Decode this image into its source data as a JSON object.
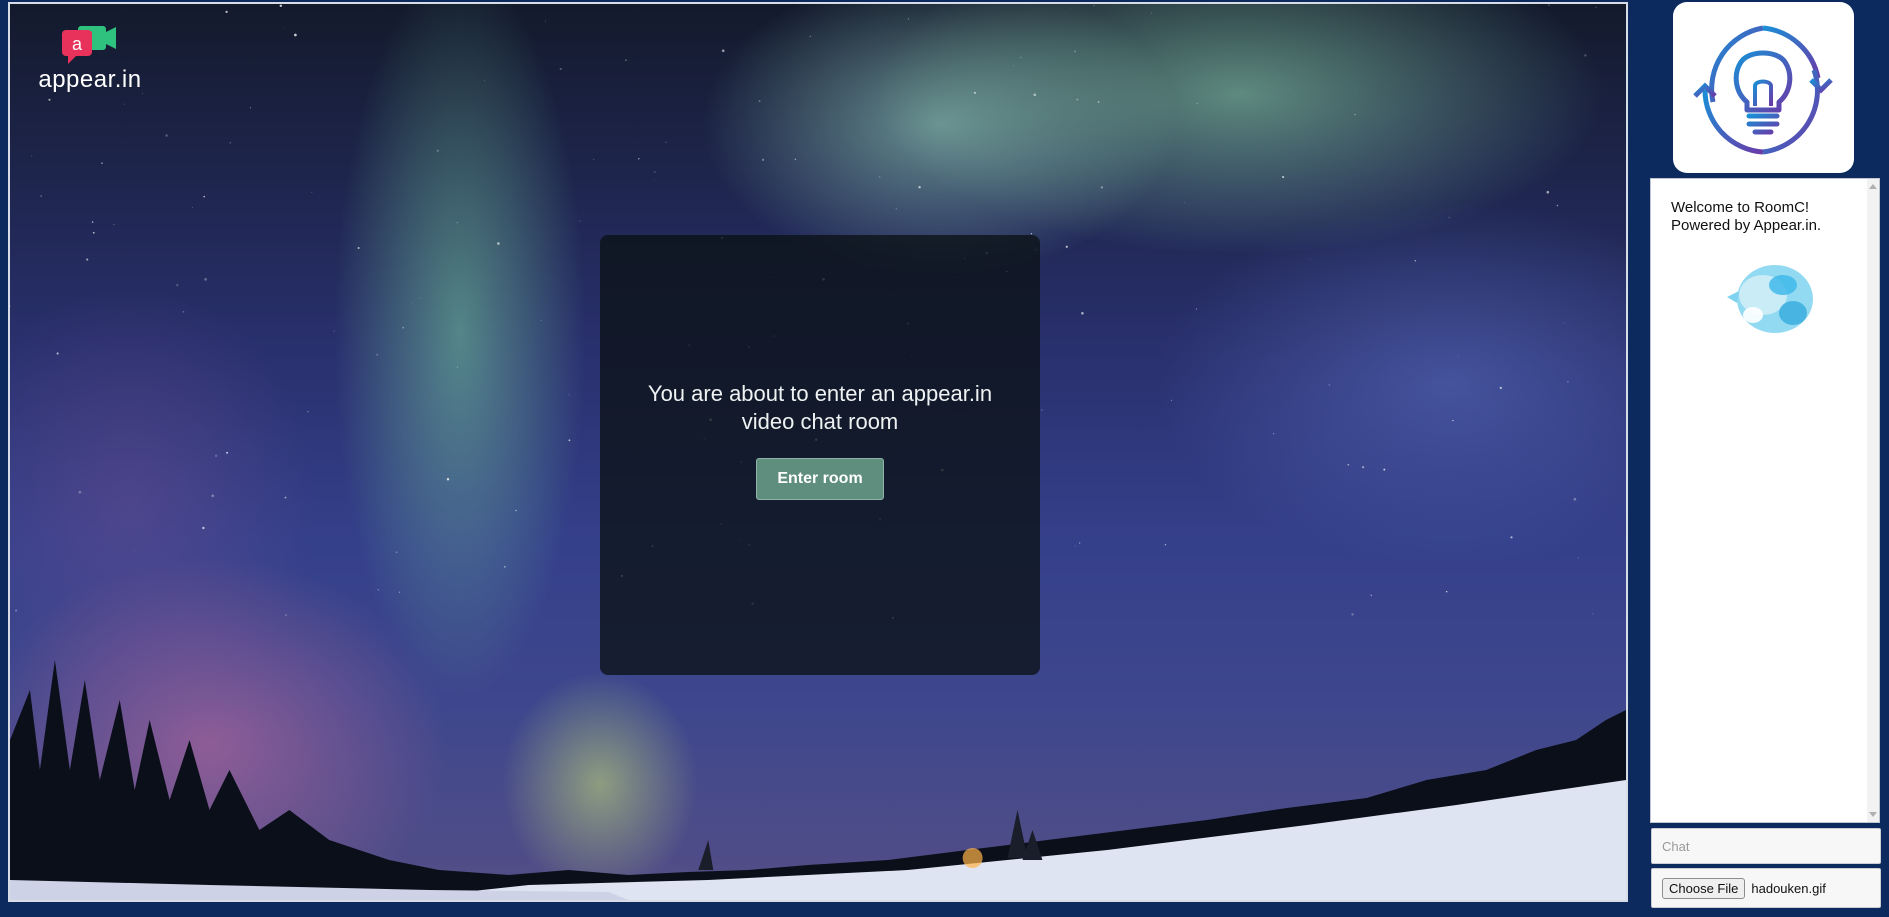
{
  "logo": {
    "text": "appear.in",
    "mark_letter": "a",
    "icon": "appear-in-logo-icon"
  },
  "modal": {
    "message": "You are about to enter an appear.in video chat room",
    "enter_button": "Enter room"
  },
  "sidebar": {
    "brand_icon": "lightbulb-refresh-icon",
    "chat": {
      "welcome_line1": "Welcome to RoomC!",
      "welcome_line2": "Powered by Appear.in.",
      "sticker_icon": "hadouken-sticker-icon"
    },
    "chat_input": {
      "placeholder": "Chat",
      "value": ""
    },
    "file_picker": {
      "button_label": "Choose File",
      "file_name": "hadouken.gif"
    }
  },
  "colors": {
    "page_bg": "#0d2a5e",
    "button_green": "#5f8d7e",
    "logo_pink": "#e8325b",
    "logo_green": "#2ec27e",
    "brand_gradient_start": "#1a8fd6",
    "brand_gradient_end": "#6a3aa8"
  }
}
